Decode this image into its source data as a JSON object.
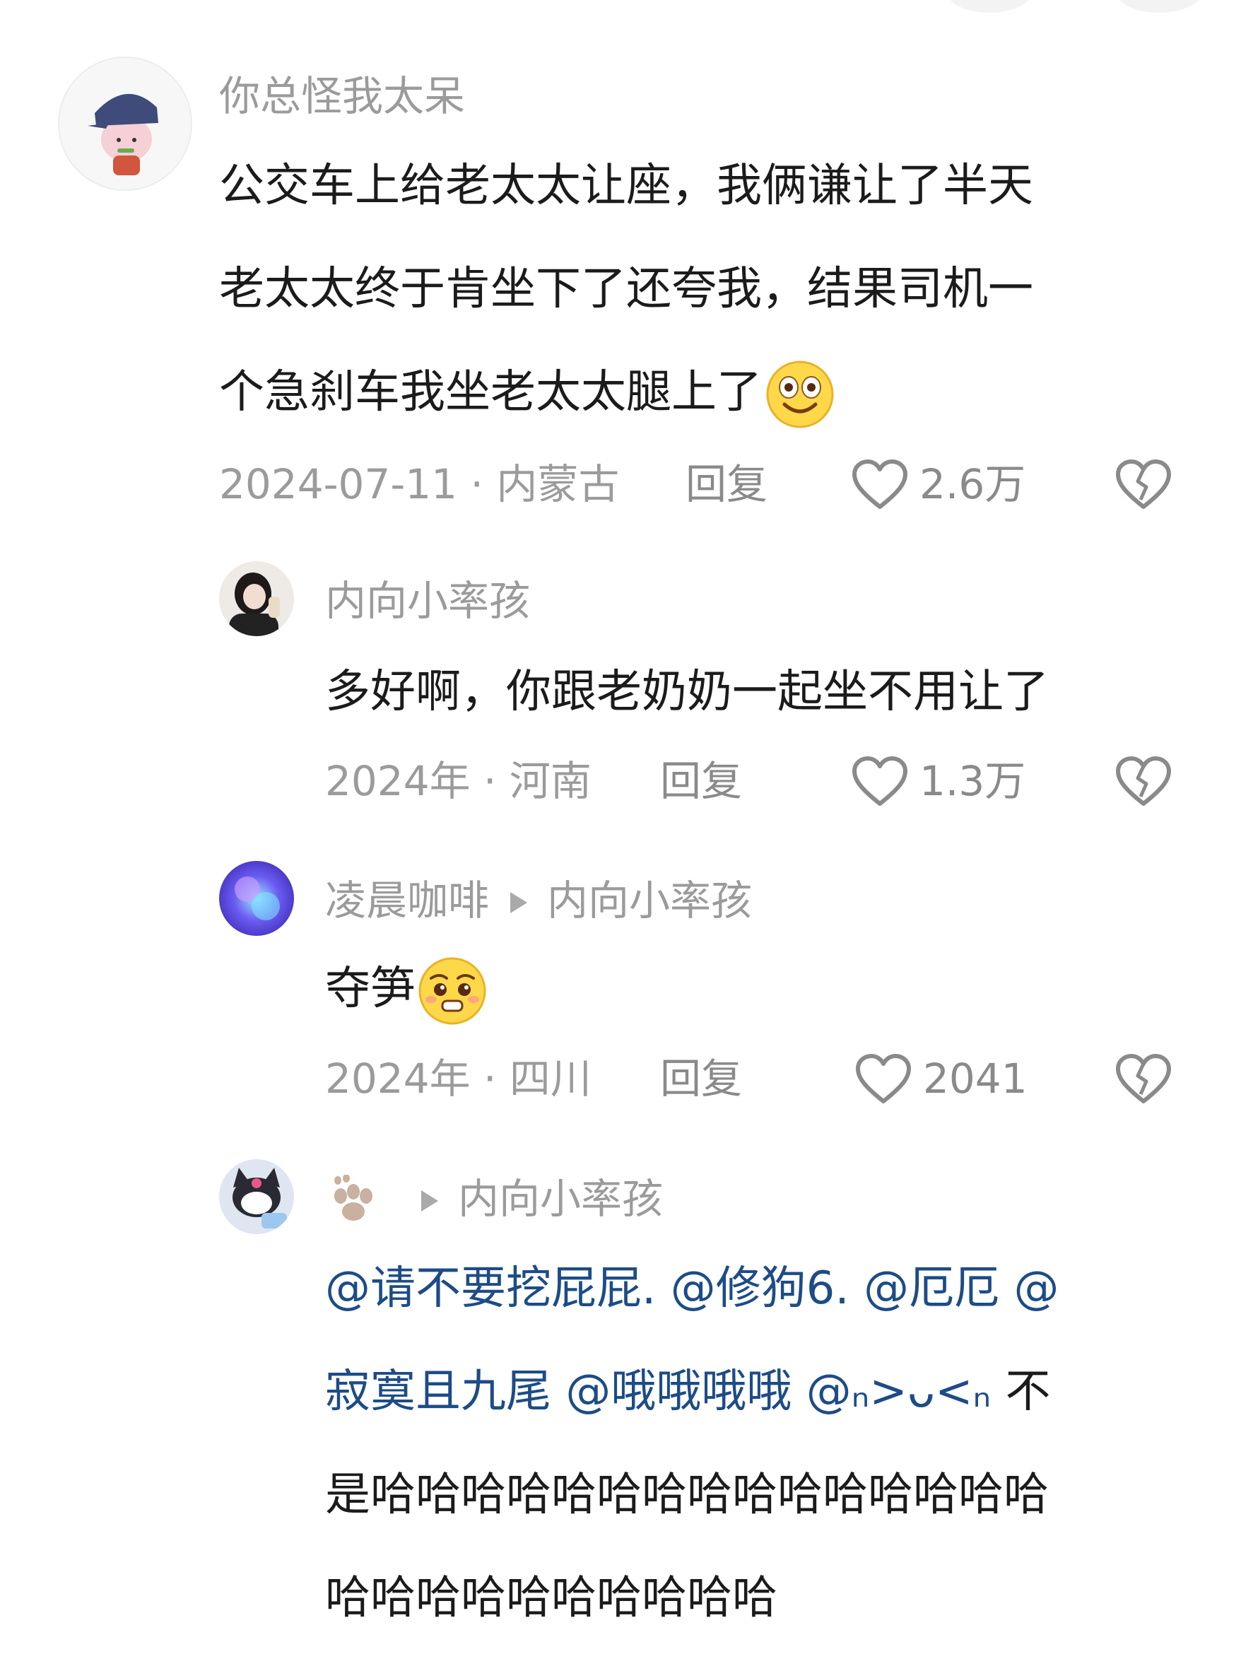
{
  "comments": [
    {
      "username": "你总怪我太呆",
      "lines": [
        "公交车上给老太太让座，我俩谦让了半天",
        "老太太终于肯坐下了还夸我，结果司机一",
        "个急刹车我坐老太太腿上了"
      ],
      "emoji": "smile-emoji",
      "date_location": "2024-07-11 · 内蒙古",
      "reply_label": "回复",
      "likes": "2.6万"
    },
    {
      "username": "内向小率孩",
      "lines": [
        "多好啊，你跟老奶奶一起坐不用让了"
      ],
      "date_location": "2024年 · 河南",
      "reply_label": "回复",
      "likes": "1.3万"
    },
    {
      "username": "凌晨咖啡",
      "reply_to": "内向小率孩",
      "lines": [
        "夺笋"
      ],
      "emoji": "pleading-emoji",
      "date_location": "2024年 · 四川",
      "reply_label": "回复",
      "likes": "2041"
    },
    {
      "username_icon": "paw-icon",
      "reply_to": "内向小率孩",
      "mentions": [
        "@请不要挖屁屁.",
        "@修狗6.",
        "@厄厄",
        "@",
        "寂寞且九尾",
        "@哦哦哦哦",
        "@ₙ>ᴗ<ₙ"
      ],
      "line2_tail": "不",
      "lines": [
        "是哈哈哈哈哈哈哈哈哈哈哈哈哈哈哈",
        "哈哈哈哈哈哈哈哈哈哈"
      ]
    }
  ]
}
